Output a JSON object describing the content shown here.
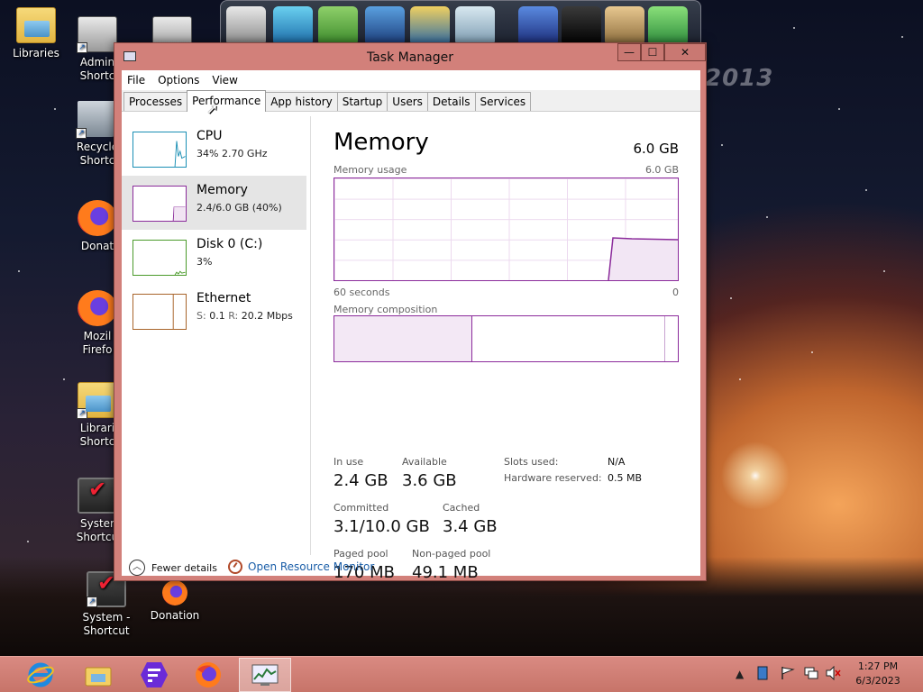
{
  "desktop": {
    "watermark": "2013",
    "icons": [
      {
        "label": "Libraries",
        "label2": ""
      },
      {
        "label": "Admin",
        "label2": "Shortc"
      },
      {
        "label": "Recycle",
        "label2": "Shortc"
      },
      {
        "label": "Donat",
        "label2": ""
      },
      {
        "label": "Mozil",
        "label2": "Firefo"
      },
      {
        "label": "Librari",
        "label2": "Shortc"
      },
      {
        "label": "Syster",
        "label2": "Shortcu"
      },
      {
        "label": "System -",
        "label2": "Shortcut"
      },
      {
        "label": "Donation",
        "label2": ""
      }
    ]
  },
  "window": {
    "title": "Task Manager",
    "caption": {
      "minimize": "—",
      "maximize": "☐",
      "close": "✕"
    },
    "menu": [
      "File",
      "Options",
      "View"
    ],
    "tabs": [
      "Processes",
      "Performance",
      "App history",
      "Startup",
      "Users",
      "Details",
      "Services"
    ],
    "active_tab": "Performance"
  },
  "sidebar": {
    "items": [
      {
        "name": "CPU",
        "value": "34%  2.70 GHz",
        "color": "#1a8fb4"
      },
      {
        "name": "Memory",
        "value": "2.4/6.0 GB (40%)",
        "color": "#8b2b9b"
      },
      {
        "name": "Disk 0 (C:)",
        "value": "3%",
        "color": "#4a9a2a"
      },
      {
        "name": "Ethernet",
        "value_prefix_s": "S:",
        "value_s": "0.1",
        "value_prefix_r": "R:",
        "value_r": "20.2 Mbps",
        "color": "#a8642a"
      }
    ]
  },
  "memory": {
    "title": "Memory",
    "total": "6.0 GB",
    "usage_label": "Memory usage",
    "usage_max": "6.0 GB",
    "time_label": "60 seconds",
    "time_end": "0",
    "composition_label": "Memory composition",
    "in_use_label": "In use",
    "in_use": "2.4 GB",
    "available_label": "Available",
    "available": "3.6 GB",
    "committed_label": "Committed",
    "committed": "3.1/10.0 GB",
    "cached_label": "Cached",
    "cached": "3.4 GB",
    "paged_label": "Paged pool",
    "paged": "170 MB",
    "nonpaged_label": "Non-paged pool",
    "nonpaged": "49.1 MB",
    "slots_label": "Slots used:",
    "slots": "N/A",
    "hw_label": "Hardware reserved:",
    "hw": "0.5 MB",
    "accent": "#8b2b9b"
  },
  "footer": {
    "fewer": "Fewer details",
    "resmon": "Open Resource Monitor"
  },
  "taskbar": {
    "time": "1:27 PM",
    "date": "6/3/2023"
  }
}
